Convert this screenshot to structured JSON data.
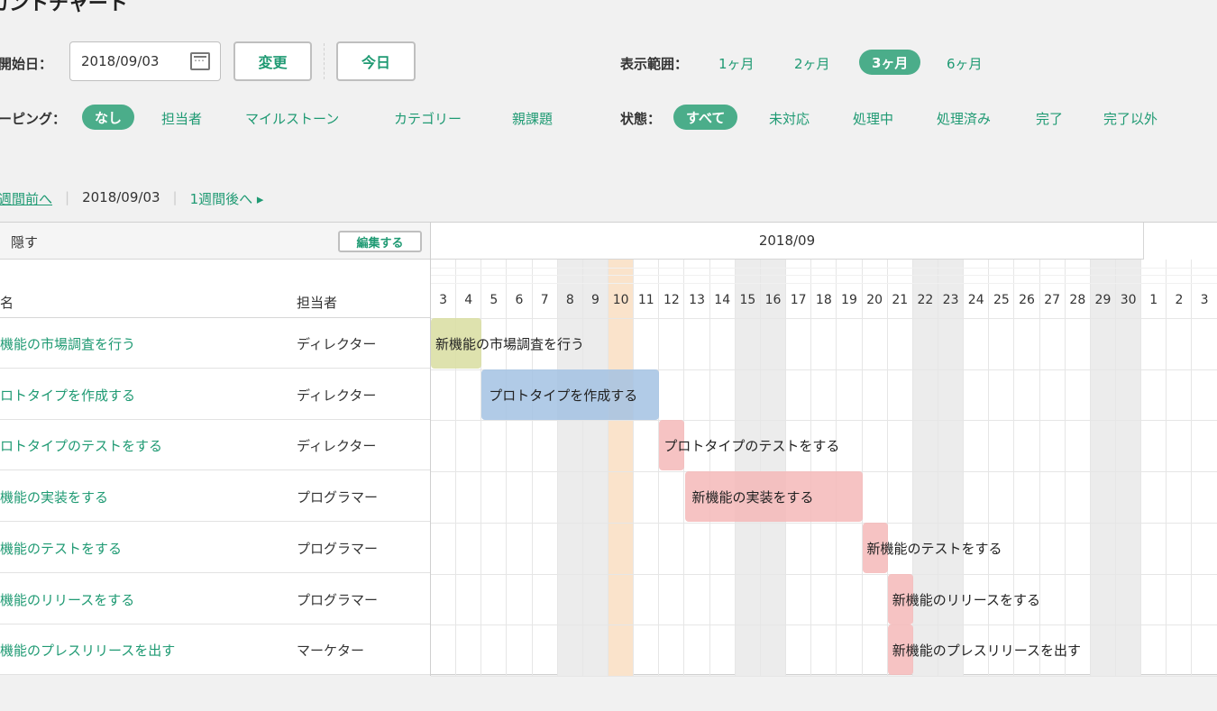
{
  "title": "カントチャート",
  "start_date": {
    "label": "開始日：",
    "value": "2018/09/03"
  },
  "buttons": {
    "change": "変更",
    "today": "今日"
  },
  "range": {
    "label": "表示範囲：",
    "options": [
      "1ヶ月",
      "2ヶ月",
      "3ヶ月",
      "6ヶ月"
    ],
    "selected": "3ヶ月"
  },
  "grouping": {
    "label": "ーピング：",
    "options": [
      "なし",
      "担当者",
      "マイルストーン",
      "カテゴリー",
      "親課題"
    ],
    "selected": "なし"
  },
  "status": {
    "label": "状態：",
    "options": [
      "すべて",
      "未対応",
      "処理中",
      "処理済み",
      "完了",
      "完了以外"
    ],
    "selected": "すべて"
  },
  "nav": {
    "prev": "週間前へ",
    "sep1": "|",
    "current": "2018/09/03",
    "sep2": "|",
    "next": "1週間後へ ▸"
  },
  "table": {
    "hide_label": "隠す",
    "edit_label": "編集する",
    "col_name": "名",
    "col_assignee": "担当者",
    "month": "2018/09",
    "days": [
      "3",
      "4",
      "5",
      "6",
      "7",
      "8",
      "9",
      "10",
      "11",
      "12",
      "13",
      "14",
      "15",
      "16",
      "17",
      "18",
      "19",
      "20",
      "21",
      "22",
      "23",
      "24",
      "25",
      "26",
      "27",
      "28",
      "29",
      "30",
      "1",
      "2",
      "3"
    ],
    "weekend_days": [
      "8",
      "9",
      "15",
      "16",
      "22",
      "23",
      "29",
      "30"
    ],
    "today_day": "10",
    "tasks": [
      {
        "name": "機能の市場調査を行う",
        "assignee": "ディレクター",
        "bar_label": "新機能の市場調査を行う",
        "start_day": "3",
        "end_day": "4",
        "color": "#d8dda0"
      },
      {
        "name": "ロトタイプを作成する",
        "assignee": "ディレクター",
        "bar_label": "プロトタイプを作成する",
        "start_day": "5",
        "end_day": "11",
        "color": "#a3c2e3"
      },
      {
        "name": "ロトタイプのテストをする",
        "assignee": "ディレクター",
        "bar_label": "プロトタイプのテストをする",
        "start_day": "12",
        "end_day": "12",
        "color": "#f5b9b9"
      },
      {
        "name": "機能の実装をする",
        "assignee": "プログラマー",
        "bar_label": "新機能の実装をする",
        "start_day": "13",
        "end_day": "19",
        "color": "#f5b9b9"
      },
      {
        "name": "機能のテストをする",
        "assignee": "プログラマー",
        "bar_label": "新機能のテストをする",
        "start_day": "20",
        "end_day": "20",
        "color": "#f5b9b9"
      },
      {
        "name": "機能のリリースをする",
        "assignee": "プログラマー",
        "bar_label": "新機能のリリースをする",
        "start_day": "21",
        "end_day": "21",
        "color": "#f5b9b9"
      },
      {
        "name": "機能のプレスリリースを出す",
        "assignee": "マーケター",
        "bar_label": "新機能のプレスリリースを出す",
        "start_day": "21",
        "end_day": "21",
        "color": "#f5b9b9"
      }
    ]
  },
  "colors": {
    "accent": "#1f9a73",
    "pill": "#4bad8a",
    "weekend": "#ececec",
    "today": "#fae3cb"
  }
}
